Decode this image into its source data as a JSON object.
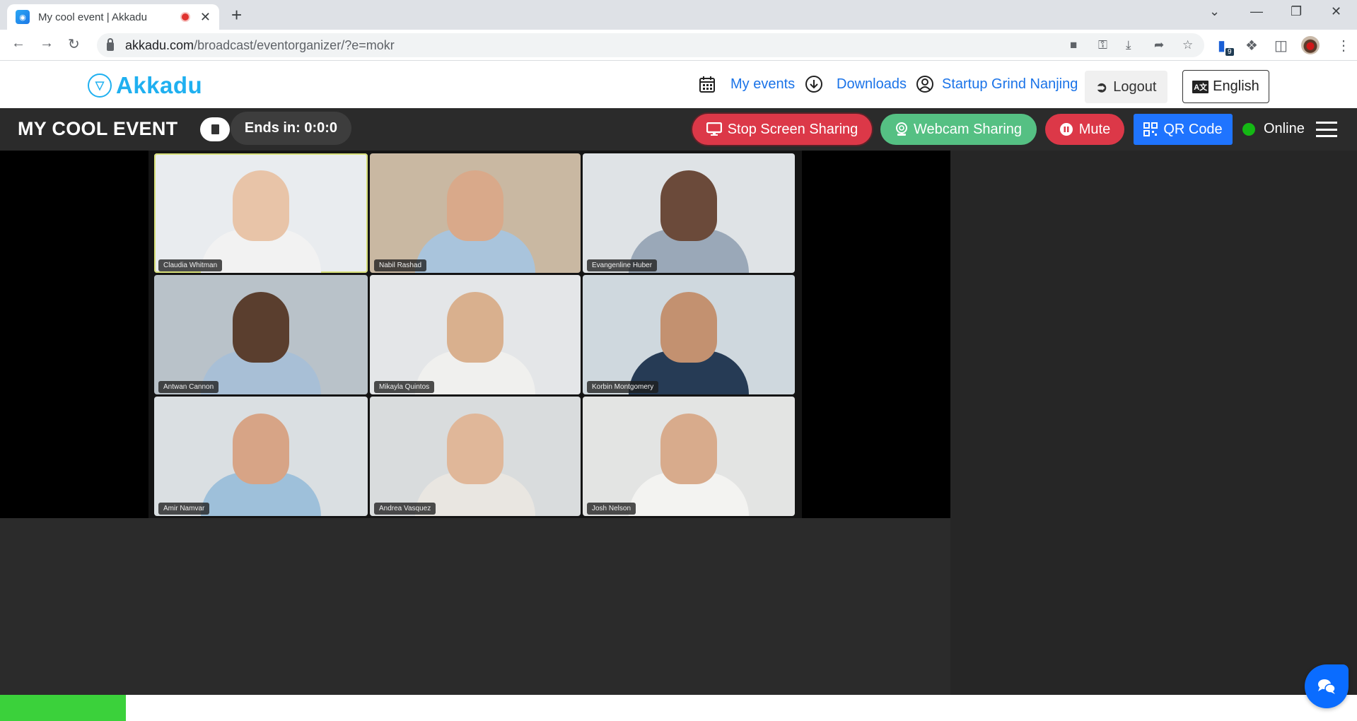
{
  "browser": {
    "tab_title": "My cool event | Akkadu",
    "tab_recording": true,
    "new_tab_label": "+",
    "url_host": "akkadu.com",
    "url_path": "/broadcast/eventorganizer/?e=mokr",
    "extension_badge": "9"
  },
  "header": {
    "brand": "Akkadu",
    "nav": {
      "my_events": "My events",
      "downloads": "Downloads",
      "account": "Startup Grind Nanjing",
      "logout": "Logout",
      "language": "English"
    }
  },
  "toolbar": {
    "event_title": "MY COOL EVENT",
    "ends_in": "Ends in: 0:0:0",
    "stop_screen_sharing": "Stop Screen Sharing",
    "webcam_sharing": "Webcam Sharing",
    "mute": "Mute",
    "qr_code": "QR Code",
    "status": "Online",
    "colors": {
      "stop_share": "#dc3848",
      "webcam": "#55c083",
      "mute": "#dc3848",
      "qr": "#1f74ff",
      "online": "#14b814"
    }
  },
  "participants": [
    {
      "name": "Claudia Whitman",
      "active": true
    },
    {
      "name": "Nabil Rashad",
      "active": false
    },
    {
      "name": "Evangenline Huber",
      "active": false
    },
    {
      "name": "Antwan Cannon",
      "active": false
    },
    {
      "name": "Mikayla Quintos",
      "active": false
    },
    {
      "name": "Korbin Montgomery",
      "active": false
    },
    {
      "name": "Amir Namvar",
      "active": false
    },
    {
      "name": "Andrea Vasquez",
      "active": false
    },
    {
      "name": "Josh Nelson",
      "active": false
    }
  ],
  "progress": {
    "fraction": 0.093,
    "color": "#3bd13b"
  }
}
